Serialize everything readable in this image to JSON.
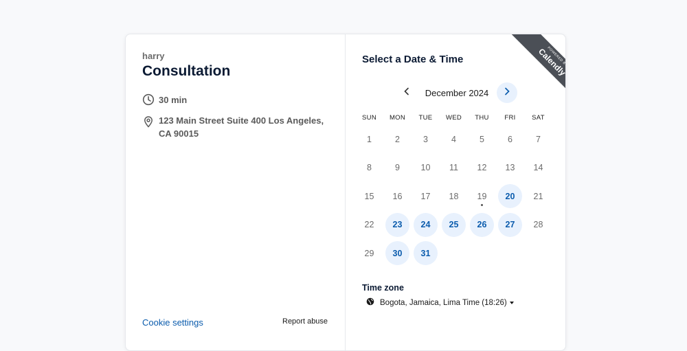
{
  "event": {
    "organizer": "harry",
    "title": "Consultation",
    "duration": "30 min",
    "location": "123 Main Street Suite 400 Los Angeles, CA 90015"
  },
  "footer": {
    "cookie_settings": "Cookie settings",
    "report_abuse": "Report abuse"
  },
  "scheduler": {
    "title": "Select a Date & Time",
    "month": "December 2024",
    "weekdays": [
      "SUN",
      "MON",
      "TUE",
      "WED",
      "THU",
      "FRI",
      "SAT"
    ],
    "days": [
      {
        "d": "1",
        "avail": false
      },
      {
        "d": "2",
        "avail": false
      },
      {
        "d": "3",
        "avail": false
      },
      {
        "d": "4",
        "avail": false
      },
      {
        "d": "5",
        "avail": false
      },
      {
        "d": "6",
        "avail": false
      },
      {
        "d": "7",
        "avail": false
      },
      {
        "d": "8",
        "avail": false
      },
      {
        "d": "9",
        "avail": false
      },
      {
        "d": "10",
        "avail": false
      },
      {
        "d": "11",
        "avail": false
      },
      {
        "d": "12",
        "avail": false
      },
      {
        "d": "13",
        "avail": false
      },
      {
        "d": "14",
        "avail": false
      },
      {
        "d": "15",
        "avail": false
      },
      {
        "d": "16",
        "avail": false
      },
      {
        "d": "17",
        "avail": false
      },
      {
        "d": "18",
        "avail": false
      },
      {
        "d": "19",
        "avail": false,
        "today": true
      },
      {
        "d": "20",
        "avail": true
      },
      {
        "d": "21",
        "avail": false
      },
      {
        "d": "22",
        "avail": false
      },
      {
        "d": "23",
        "avail": true
      },
      {
        "d": "24",
        "avail": true
      },
      {
        "d": "25",
        "avail": true
      },
      {
        "d": "26",
        "avail": true
      },
      {
        "d": "27",
        "avail": true
      },
      {
        "d": "28",
        "avail": false
      },
      {
        "d": "29",
        "avail": false
      },
      {
        "d": "30",
        "avail": true
      },
      {
        "d": "31",
        "avail": true
      }
    ],
    "timezone_label": "Time zone",
    "timezone_value": "Bogota, Jamaica, Lima Time (18:26)"
  },
  "ribbon": {
    "small": "POWERED BY",
    "brand": "Calendly"
  },
  "colors": {
    "accent": "#0b5cad",
    "available_bg": "#e8f1fd",
    "title": "#0b1a33"
  },
  "icons": {
    "duration": "clock-icon",
    "location": "map-pin-icon",
    "prev": "chevron-left-icon",
    "next": "chevron-right-icon",
    "timezone": "globe-icon",
    "dropdown": "caret-down-icon"
  }
}
